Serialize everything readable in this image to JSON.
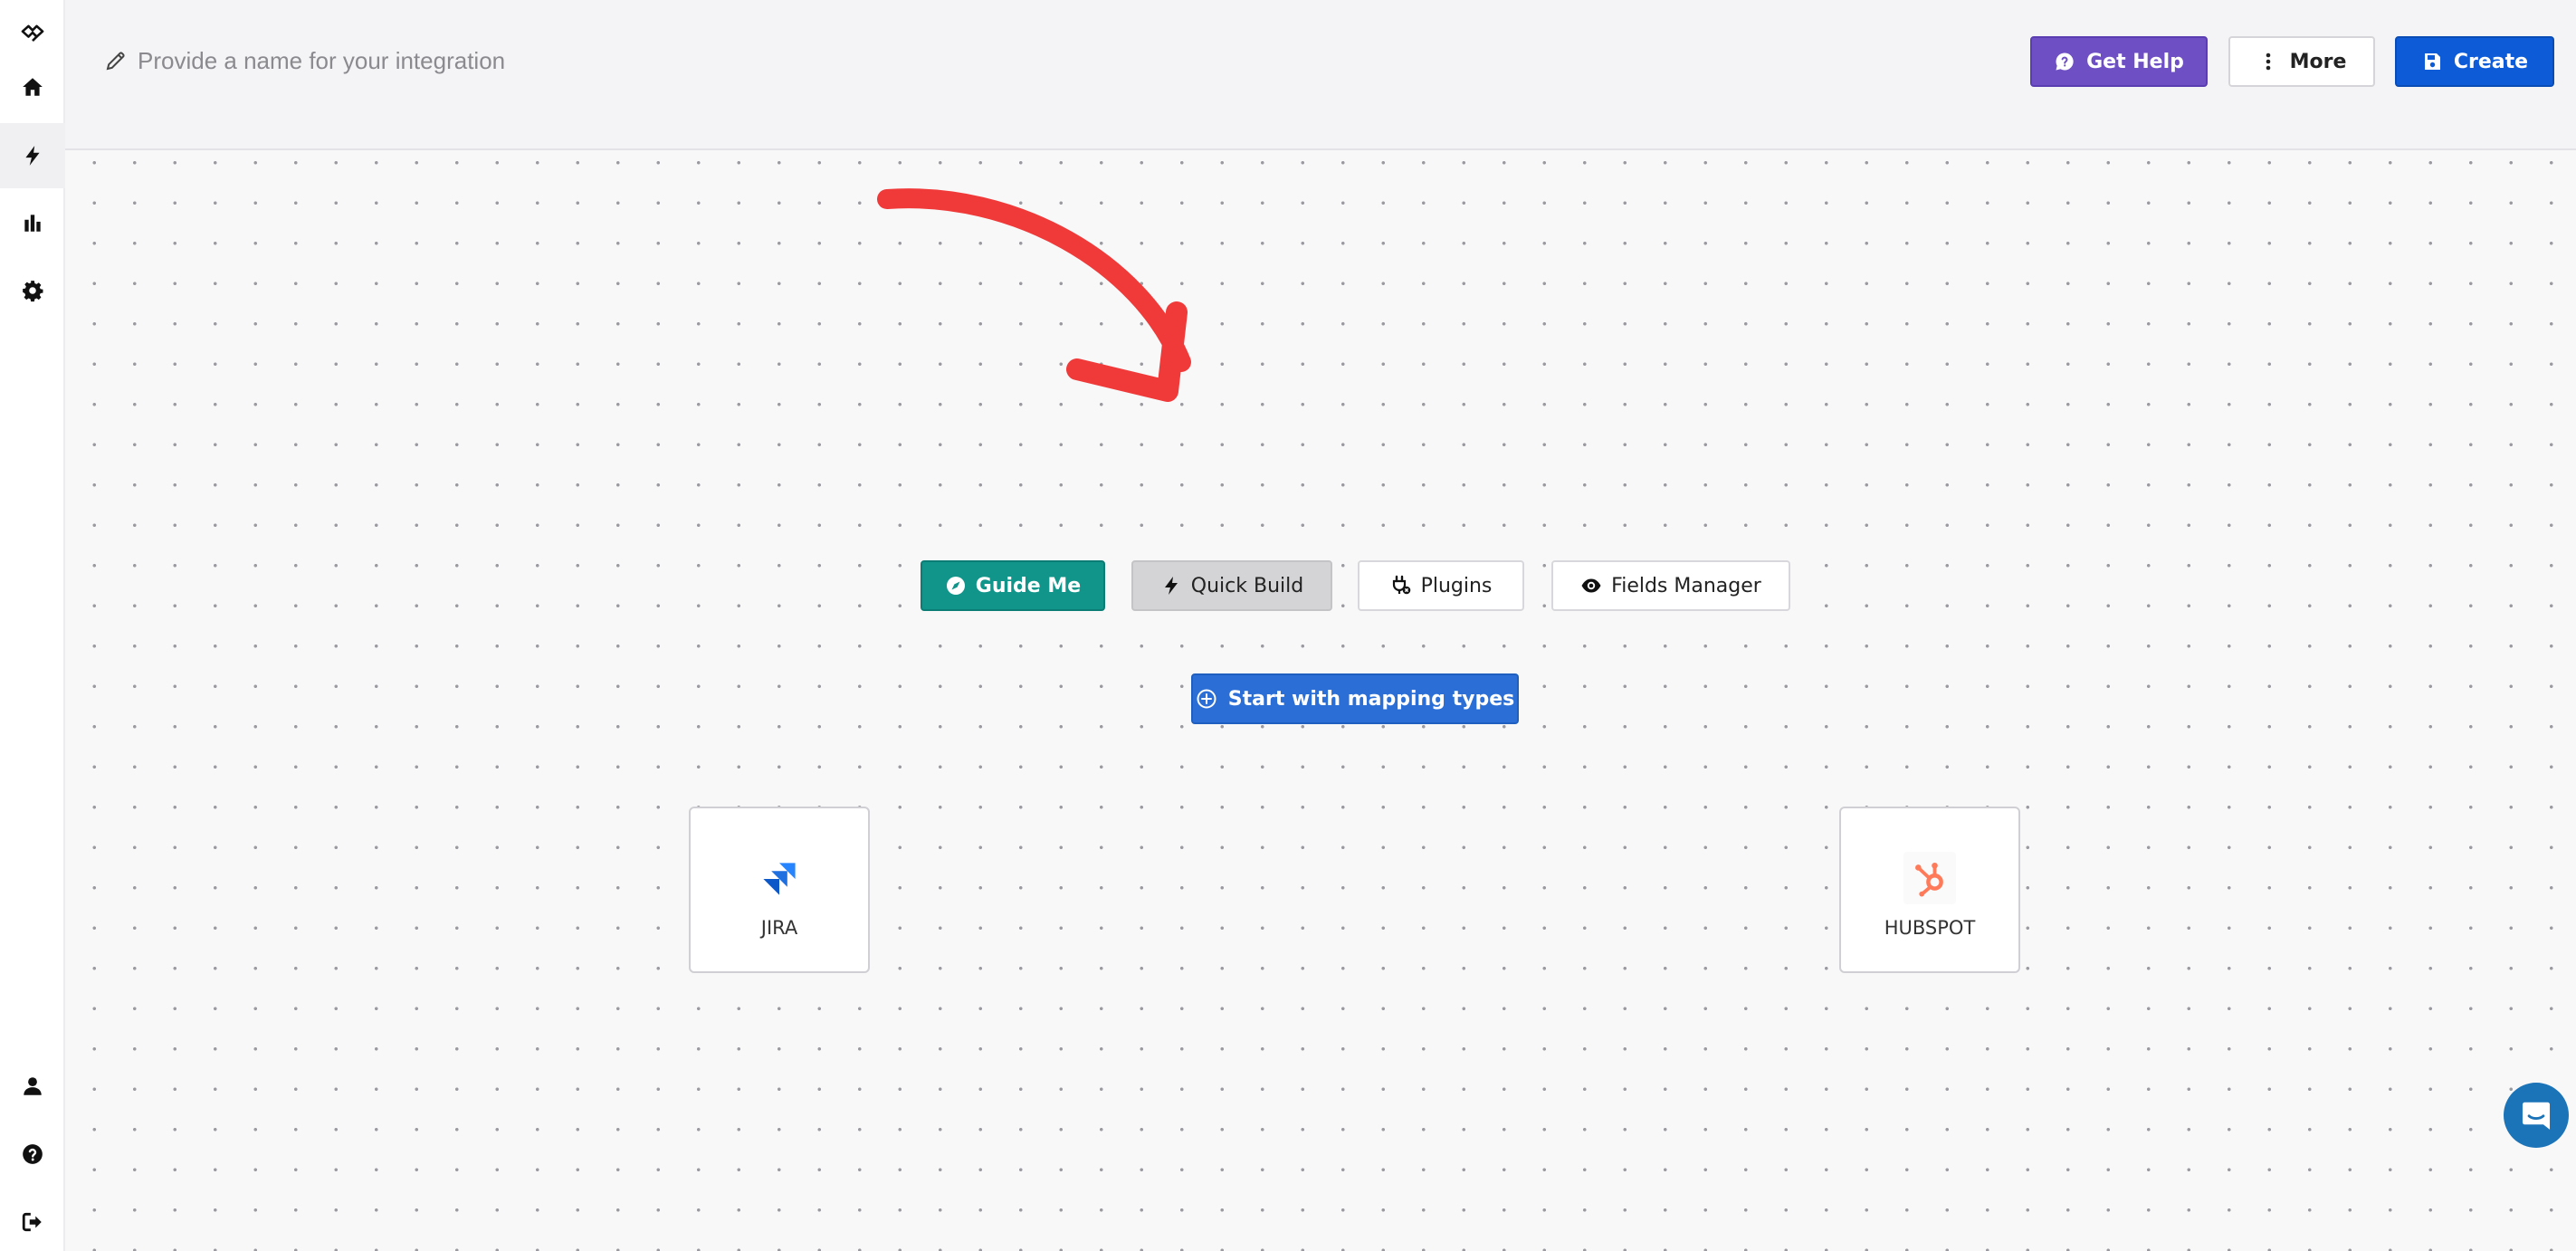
{
  "header": {
    "name_placeholder": "Provide a name for your integration",
    "get_help_label": "Get Help",
    "more_label": "More",
    "create_label": "Create"
  },
  "toolbar": {
    "guide_me_label": "Guide Me",
    "quick_build_label": "Quick Build",
    "plugins_label": "Plugins",
    "fields_manager_label": "Fields Manager"
  },
  "start_button_label": "Start with mapping types",
  "nodes": {
    "left": {
      "label": "JIRA",
      "icon": "jira-icon"
    },
    "right": {
      "label": "HUBSPOT",
      "icon": "hubspot-icon"
    }
  },
  "sidebar": {
    "top_items": [
      "logo-icon",
      "home-icon",
      "bolt-icon",
      "chart-icon",
      "gear-icon"
    ],
    "bottom_items": [
      "user-icon",
      "help-icon",
      "logout-icon"
    ],
    "active_item": "bolt-icon"
  },
  "colors": {
    "get_help": "#6e4fc4",
    "create": "#0d5bd7",
    "guide_me": "#11958a",
    "start_button": "#2b6fd6",
    "annotation_arrow": "#f03a3a",
    "chat_bubble": "#1b73b8"
  }
}
